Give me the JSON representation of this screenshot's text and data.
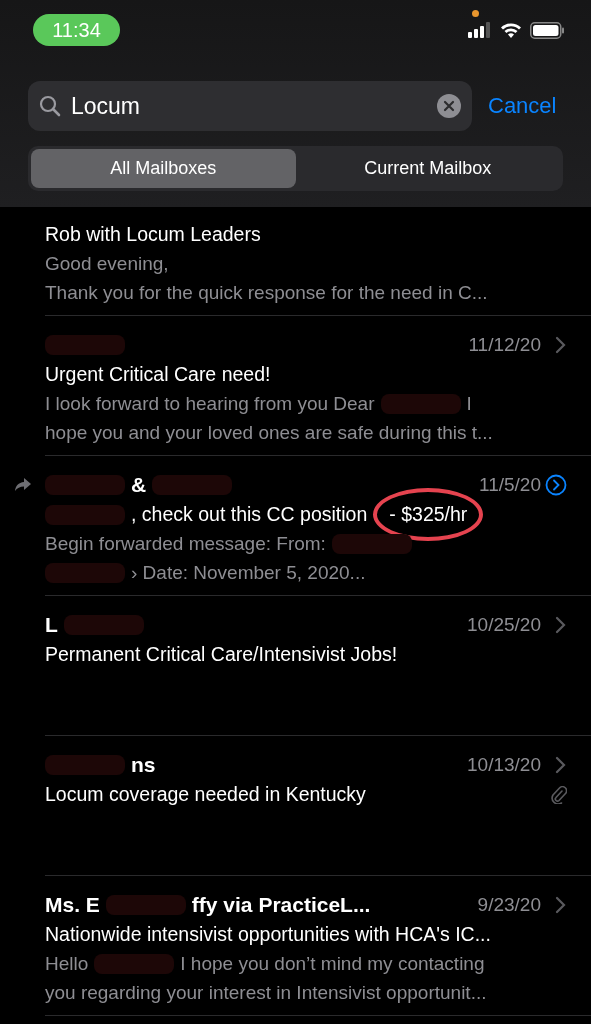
{
  "status_bar": {
    "time": "11:34",
    "recording_dot": true
  },
  "search": {
    "value": "Locum",
    "cancel": "Cancel"
  },
  "scope": [
    {
      "label": "All Mailboxes",
      "selected": true
    },
    {
      "label": "Current Mailbox",
      "selected": false
    }
  ],
  "messages": [
    {
      "subject": [
        {
          "kind": "text",
          "text": "Rob with Locum Leaders"
        }
      ],
      "preview": [
        [
          {
            "kind": "text",
            "text": "Good evening,"
          }
        ],
        [
          {
            "kind": "text",
            "text": "Thank you for the quick response for the need in C..."
          }
        ]
      ],
      "forwarded": false,
      "selected": false,
      "attachment": false
    },
    {
      "sender": [
        {
          "kind": "redacted"
        }
      ],
      "date": "11/12/20",
      "subject": [
        {
          "kind": "text",
          "text": "Urgent Critical Care need!"
        }
      ],
      "preview": [
        [
          {
            "kind": "text",
            "text": "I look forward to hearing from you Dear"
          },
          {
            "kind": "redacted"
          },
          {
            "kind": "text",
            "text": "I"
          }
        ],
        [
          {
            "kind": "text",
            "text": "hope you and your loved ones are safe during this t..."
          }
        ]
      ],
      "forwarded": false,
      "selected": false,
      "attachment": false
    },
    {
      "sender": [
        {
          "kind": "redacted"
        },
        {
          "kind": "text",
          "text": "&"
        },
        {
          "kind": "redacted"
        }
      ],
      "date": "11/5/20",
      "subject": [
        {
          "kind": "redacted"
        },
        {
          "kind": "text",
          "text": ", check out this CC position"
        },
        {
          "kind": "circled",
          "text": "- $325/hr"
        }
      ],
      "preview": [
        [
          {
            "kind": "text",
            "text": "Begin forwarded message: From:"
          },
          {
            "kind": "redacted"
          }
        ],
        [
          {
            "kind": "redacted"
          },
          {
            "kind": "text",
            "text": "› Date: November 5, 2020..."
          }
        ]
      ],
      "forwarded": true,
      "selected": true,
      "attachment": false
    },
    {
      "sender": [
        {
          "kind": "text",
          "text": "L"
        },
        {
          "kind": "redacted"
        }
      ],
      "date": "10/25/20",
      "subject": [
        {
          "kind": "text",
          "text": "Permanent Critical Care/Intensivist Jobs!"
        }
      ],
      "forwarded": false,
      "selected": false,
      "attachment": false
    },
    {
      "sender": [
        {
          "kind": "redacted"
        },
        {
          "kind": "text",
          "text": "ns"
        }
      ],
      "date": "10/13/20",
      "subject": [
        {
          "kind": "text",
          "text": "Locum coverage needed in Kentucky"
        }
      ],
      "forwarded": false,
      "selected": false,
      "attachment": true
    },
    {
      "sender": [
        {
          "kind": "text",
          "text": "Ms. E"
        },
        {
          "kind": "redacted"
        },
        {
          "kind": "text",
          "text": "ffy via PracticeL..."
        }
      ],
      "date": "9/23/20",
      "subject": [
        {
          "kind": "text",
          "text": "Nationwide intensivist opportunities with HCA's IC..."
        }
      ],
      "preview": [
        [
          {
            "kind": "text",
            "text": "Hello"
          },
          {
            "kind": "redacted"
          },
          {
            "kind": "text",
            "text": "I hope you don’t mind my contacting"
          }
        ],
        [
          {
            "kind": "text",
            "text": "you regarding your interest in Intensivist opportunit..."
          }
        ]
      ],
      "forwarded": false,
      "selected": false,
      "attachment": false
    }
  ]
}
